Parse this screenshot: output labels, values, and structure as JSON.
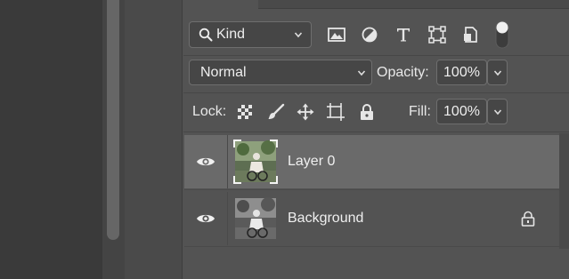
{
  "filter": {
    "kind_label": "Kind",
    "icons": [
      "pixel-filter-icon",
      "adjustment-filter-icon",
      "type-filter-icon",
      "shape-filter-icon",
      "smart-object-filter-icon",
      "filter-toggle-icon"
    ]
  },
  "blend": {
    "mode": "Normal",
    "opacity_label": "Opacity:",
    "opacity_value": "100%"
  },
  "lock": {
    "label": "Lock:",
    "icons": [
      "lock-transparent-pixels-icon",
      "lock-image-pixels-icon",
      "lock-position-icon",
      "lock-artboard-icon",
      "lock-all-icon"
    ],
    "fill_label": "Fill:",
    "fill_value": "100%"
  },
  "layers": [
    {
      "name": "Layer 0",
      "visible": true,
      "selected": true,
      "locked": false
    },
    {
      "name": "Background",
      "visible": true,
      "selected": false,
      "locked": true
    }
  ],
  "colors": {
    "panel": "#535353",
    "selected_row": "#6a6a6a",
    "control_bg": "#464646",
    "control_border": "#6e6e6e"
  }
}
